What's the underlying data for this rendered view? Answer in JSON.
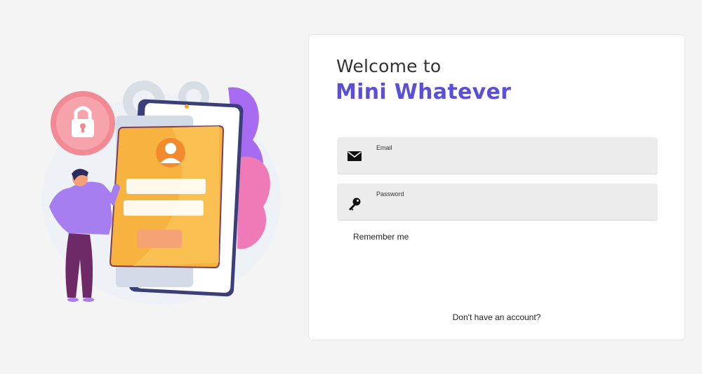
{
  "login_card": {
    "welcome_text": "Welcome to",
    "brand_name": "Mini Whatever",
    "email_field": {
      "label": "Email",
      "value": "",
      "icon": "envelope-icon"
    },
    "password_field": {
      "label": "Password",
      "value": "",
      "icon": "key-icon"
    },
    "remember_label": "Remember me",
    "signup_prompt": "Don't have an account?"
  },
  "colors": {
    "brand": "#5b4fd9",
    "field_bg": "#ececec",
    "page_bg": "#f4f4f4"
  },
  "illustration": {
    "description_icon": "secure-login-illustration"
  }
}
